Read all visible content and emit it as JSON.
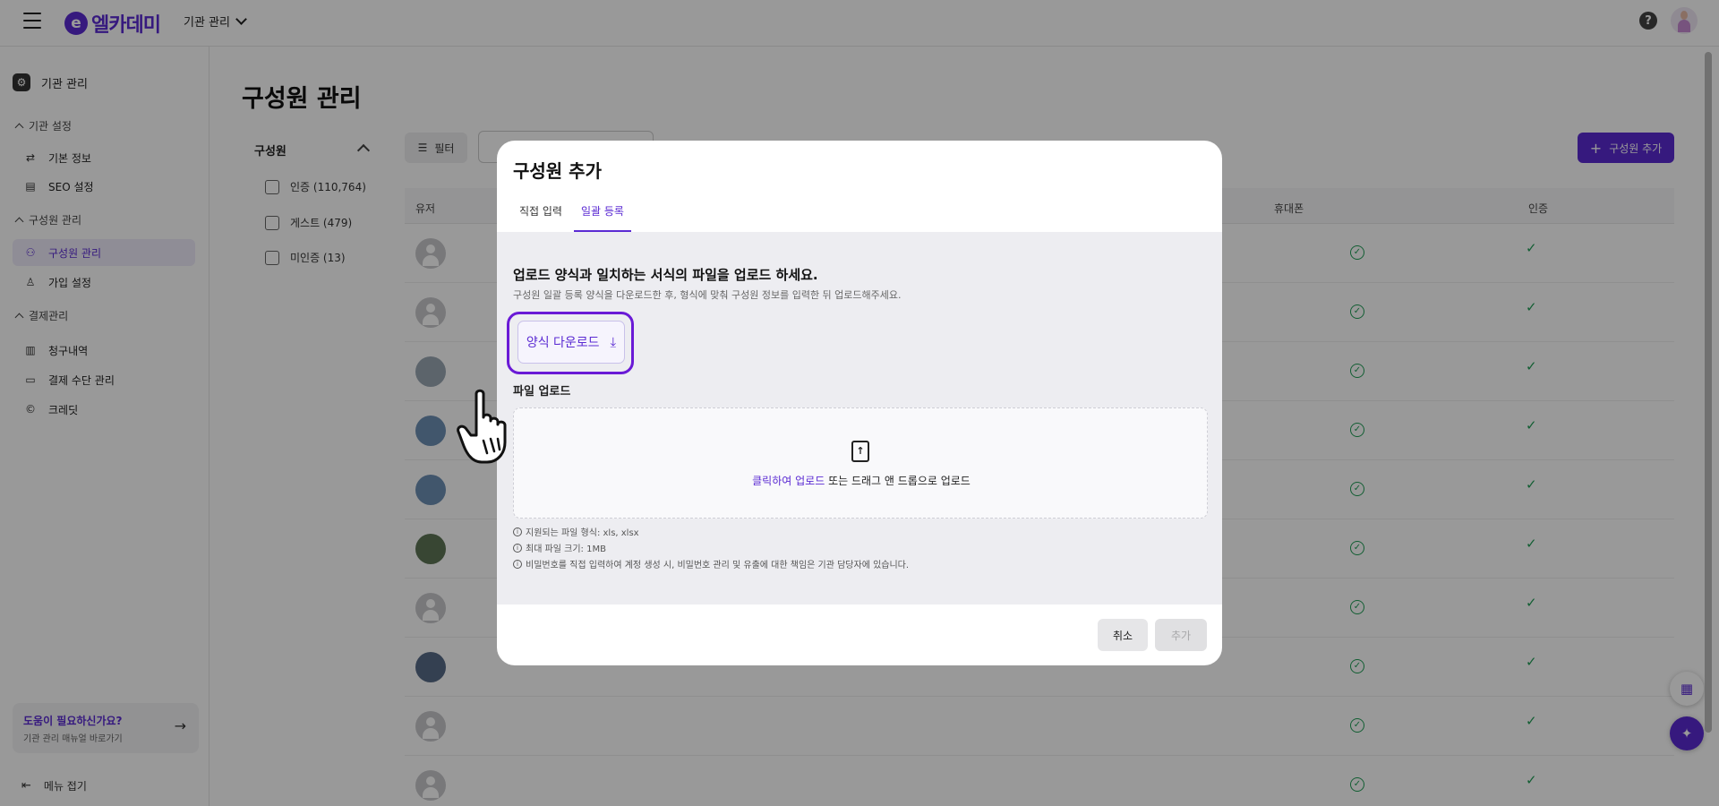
{
  "topbar": {
    "logo_mark": "e",
    "logo_text": "엘카데미",
    "org_select": "기관 관리",
    "help_glyph": "?"
  },
  "sidebar": {
    "header": "기관 관리",
    "sections": [
      {
        "label": "기관 설정"
      },
      {
        "label": "구성원 관리"
      },
      {
        "label": "결제관리"
      }
    ],
    "items": [
      {
        "label": "기본 정보",
        "icon": "sliders-icon"
      },
      {
        "label": "SEO 설정",
        "icon": "seo-icon"
      },
      {
        "label": "구성원 관리",
        "icon": "users-icon"
      },
      {
        "label": "가입 설정",
        "icon": "user-plus-icon"
      },
      {
        "label": "청구내역",
        "icon": "receipt-icon"
      },
      {
        "label": "결제 수단 관리",
        "icon": "credit-card-icon"
      },
      {
        "label": "크레딧",
        "icon": "copyright-icon"
      }
    ],
    "help_title": "도움이 필요하신가요?",
    "help_subtitle": "기관 관리 매뉴얼 바로가기",
    "collapse_label": "메뉴 접기"
  },
  "main": {
    "page_title": "구성원 관리",
    "filter_group_title": "구성원",
    "filters": [
      {
        "label": "인증 (110,764)"
      },
      {
        "label": "게스트 (479)"
      },
      {
        "label": "미인증 (13)"
      }
    ],
    "filter_button": "필터",
    "add_member_button": "구성원 추가",
    "columns": {
      "user": "유저",
      "phone": "휴대폰",
      "auth": "인증"
    },
    "rows": [
      {
        "avatar": "default"
      },
      {
        "avatar": "default"
      },
      {
        "avatar": "photo-a"
      },
      {
        "avatar": "photo-b"
      },
      {
        "avatar": "photo-b"
      },
      {
        "avatar": "photo-c"
      },
      {
        "avatar": "default"
      },
      {
        "avatar": "photo-d"
      },
      {
        "avatar": "default"
      },
      {
        "avatar": "default"
      }
    ]
  },
  "modal": {
    "title": "구성원 추가",
    "tabs": [
      {
        "label": "직접 입력",
        "active": false
      },
      {
        "label": "일괄 등록",
        "active": true
      }
    ],
    "body_title": "업로드 양식과 일치하는 서식의 파일을 업로드 하세요.",
    "body_subtitle": "구성원 일괄 등록 양식을 다운로드한 후, 형식에 맞춰 구성원 정보를 입력한 뒤 업로드해주세요.",
    "download_button": "양식 다운로드",
    "upload_label": "파일 업로드",
    "dropzone_link": "클릭하여 업로드",
    "dropzone_text": " 또는 드래그 앤 드롭으로 업로드",
    "notes": [
      "지원되는 파일 형식: xls, xlsx",
      "최대 파일 크기: 1MB",
      "비밀번호를 직접 입력하여 계정 생성 시, 비밀번호 관리 및 유출에 대한 책임은 기관 담당자에 있습니다."
    ],
    "cancel_button": "취소",
    "add_button": "추가"
  },
  "colors": {
    "accent": "#5b2bd3",
    "highlight_border": "#6a1ad6",
    "success": "#1f9d55"
  }
}
